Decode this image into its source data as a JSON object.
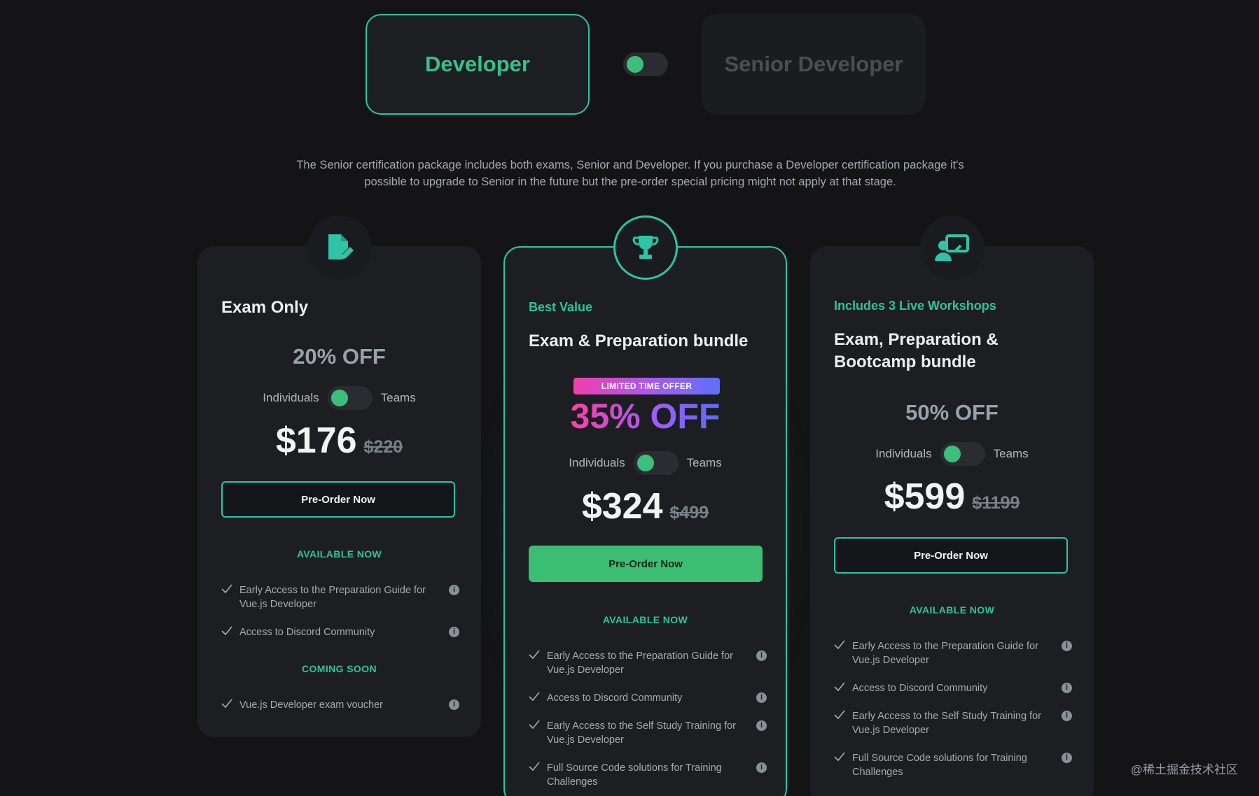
{
  "level_selector": {
    "developer_label": "Developer",
    "senior_label": "Senior Developer"
  },
  "intro_text": "The Senior certification package includes both exams, Senior and Developer. If you purchase a Developer certification package it's possible to upgrade to Senior in the future but the pre-order special pricing might not apply at that stage.",
  "toggle_labels": {
    "left": "Individuals",
    "right": "Teams"
  },
  "cards": [
    {
      "icon": "document-edit-icon",
      "eyebrow": "",
      "title": "Exam Only",
      "discount": "20% OFF",
      "price": "$176",
      "old_price": "$220",
      "button": "Pre-Order Now",
      "sections": [
        {
          "heading": "AVAILABLE NOW",
          "features": [
            "Early Access to the Preparation Guide for Vue.js Developer",
            "Access to Discord Community"
          ]
        },
        {
          "heading": "COMING SOON",
          "features": [
            "Vue.js Developer exam voucher"
          ]
        }
      ]
    },
    {
      "icon": "trophy-icon",
      "eyebrow": "Best Value",
      "title": "Exam & Preparation bundle",
      "offer_tag": "LIMITED TIME OFFER",
      "discount": "35% OFF",
      "price": "$324",
      "old_price": "$499",
      "button": "Pre-Order Now",
      "sections": [
        {
          "heading": "AVAILABLE NOW",
          "features": [
            "Early Access to the Preparation Guide for Vue.js Developer",
            "Access to Discord Community",
            "Early Access to the Self Study Training for Vue.js Developer",
            "Full Source Code solutions for Training Challenges"
          ]
        }
      ]
    },
    {
      "icon": "workshop-presenter-icon",
      "eyebrow": "Includes 3 Live Workshops",
      "title_line1": "Exam, Preparation &",
      "title_line2": "Bootcamp bundle",
      "discount": "50% OFF",
      "price": "$599",
      "old_price": "$1199",
      "button": "Pre-Order Now",
      "sections": [
        {
          "heading": "AVAILABLE NOW",
          "features": [
            "Early Access to the Preparation Guide for Vue.js Developer",
            "Access to Discord Community",
            "Early Access to the Self Study Training for Vue.js Developer",
            "Full Source Code solutions for Training Challenges"
          ]
        }
      ]
    }
  ],
  "info_glyph": "i",
  "watermark": "@稀土掘金技术社区",
  "colors": {
    "accent": "#2ec4a5",
    "green": "#3bbd72",
    "background": "#141416",
    "card": "#1d1e22"
  }
}
